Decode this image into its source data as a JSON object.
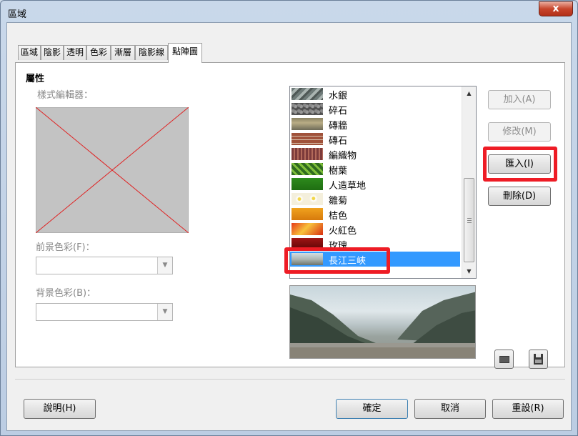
{
  "window": {
    "title": "區域",
    "close_label": "x"
  },
  "tabs": [
    {
      "label": "區域"
    },
    {
      "label": "陰影"
    },
    {
      "label": "透明"
    },
    {
      "label": "色彩"
    },
    {
      "label": "漸層"
    },
    {
      "label": "陰影線"
    },
    {
      "label": "點陣圖"
    }
  ],
  "active_tab": "點陣圖",
  "properties": {
    "heading": "屬性",
    "style_editor_label": "樣式編輯器：",
    "foreground_label": "前景色彩(F)：",
    "background_label": "背景色彩(B)：",
    "foreground_value": "",
    "background_value": ""
  },
  "bitmap_list": {
    "items": [
      {
        "label": "水銀",
        "icon": "mercury-swatch"
      },
      {
        "label": "碎石",
        "icon": "gravel-swatch"
      },
      {
        "label": "磚牆",
        "icon": "wall-swatch"
      },
      {
        "label": "磚石",
        "icon": "brick-swatch"
      },
      {
        "label": "編織物",
        "icon": "weave-swatch"
      },
      {
        "label": "樹葉",
        "icon": "leaves-swatch"
      },
      {
        "label": "人造草地",
        "icon": "artificial-turf-swatch"
      },
      {
        "label": "雛菊",
        "icon": "daisy-swatch"
      },
      {
        "label": "桔色",
        "icon": "orange-swatch"
      },
      {
        "label": "火紅色",
        "icon": "fiery-swatch"
      },
      {
        "label": "玫瑰",
        "icon": "rose-swatch"
      },
      {
        "label": "長江三峽",
        "icon": "three-gorges-swatch"
      }
    ],
    "selected": "長江三峽"
  },
  "side_buttons": {
    "add": "加入(A)",
    "modify": "修改(M)",
    "import": "匯入(I)",
    "delete": "刪除(D)"
  },
  "footer": {
    "help": "說明(H)",
    "ok": "確定",
    "cancel": "取消",
    "reset": "重設(R)"
  },
  "colors": {
    "highlight": "#ee1c25",
    "selection": "#3399ff",
    "title_bar": "#c9d8ea"
  }
}
